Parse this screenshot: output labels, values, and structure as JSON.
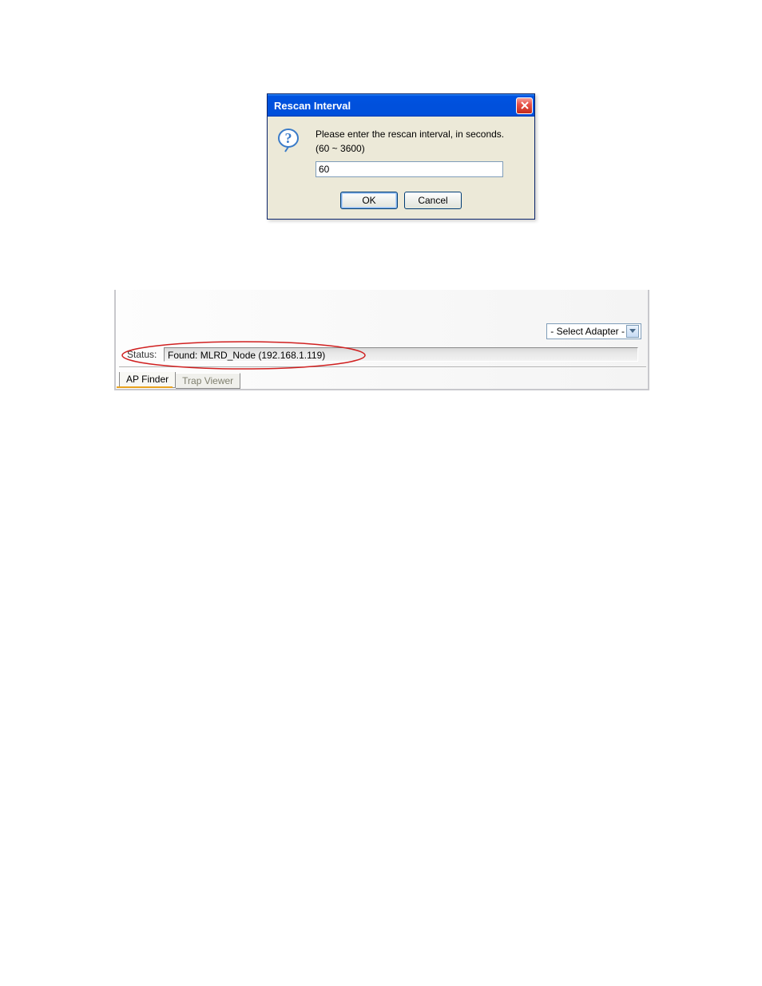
{
  "dialog": {
    "title": "Rescan Interval",
    "message_line1": "Please enter the rescan interval, in seconds.",
    "message_line2": "(60 ~ 3600)",
    "input_value": "60",
    "ok_label": "OK",
    "cancel_label": "Cancel"
  },
  "status_panel": {
    "adapter_label": "- Select Adapter -",
    "status_label": "Status:",
    "status_value": "Found: MLRD_Node (192.168.1.119)",
    "tab_ap_finder": "AP Finder",
    "tab_trap_viewer": "Trap Viewer"
  }
}
